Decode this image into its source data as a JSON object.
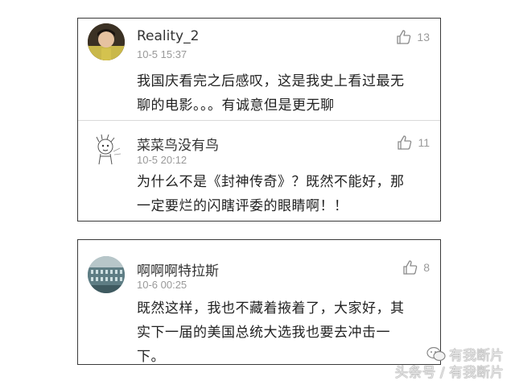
{
  "comments": [
    {
      "username": "Reality_2",
      "timestamp": "10-5 15:37",
      "likes": "13",
      "text": "我国庆看完之后感叹，这是我史上看过最无聊的电影。。。有诚意但是更无聊",
      "text_lines": [
        "我国庆看完之后感叹，这是我史上看过最无",
        "聊的电影。。。有诚意但是更无聊"
      ],
      "avatar_icon": "photo-avatar"
    },
    {
      "username": "菜菜鸟没有鸟",
      "timestamp": "10-5 20:12",
      "likes": "11",
      "text": "为什么不是《封神传奇》？既然不能好，那一定要烂的闪瞎评委的眼睛啊！！",
      "text_lines": [
        "为什么不是《封神传奇》？既然不能好，那",
        "一定要烂的闪瞎评委的眼睛啊！！"
      ],
      "avatar_icon": "cartoon-sketch-avatar"
    },
    {
      "username": "啊啊啊特拉斯",
      "timestamp": "10-6 00:25",
      "likes": "8",
      "text": "既然这样，我也不藏着掖着了，大家好，其实下一届的美国总统大选我也要去冲击一下。",
      "text_lines": [
        "既然这样，我也不藏着掖着了，大家好，其",
        "实下一届的美国总统大选我也要去冲击一",
        "下。"
      ],
      "avatar_icon": "building-photo-avatar"
    }
  ],
  "like_icon": "thumbs-up-icon",
  "watermark": {
    "line1": "有我断片",
    "line2": "头条号 / 有我断片",
    "icon": "wechat-icon"
  }
}
